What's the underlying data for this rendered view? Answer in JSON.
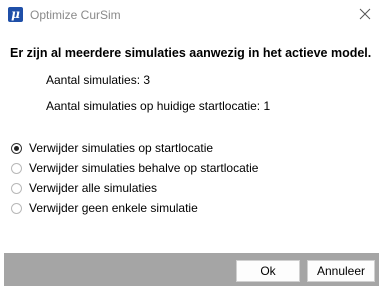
{
  "window": {
    "title": "Optimize CurSim",
    "icon": "mu-app-icon",
    "icon_glyph": "μ"
  },
  "message": {
    "heading": "Er zijn al meerdere simulaties aanwezig in het actieve model.",
    "count_line": "Aantal simulaties: 3",
    "start_line": "Aantal simulaties op huidige startlocatie: 1"
  },
  "options": [
    {
      "label": "Verwijder simulaties op startlocatie",
      "selected": true
    },
    {
      "label": "Verwijder simulaties behalve op startlocatie",
      "selected": false
    },
    {
      "label": "Verwijder alle simulaties",
      "selected": false
    },
    {
      "label": "Verwijder geen enkele simulatie",
      "selected": false
    }
  ],
  "buttons": {
    "ok_label": "Ok",
    "cancel_label": "Annuleer"
  },
  "colors": {
    "footer": "#a5a5a5",
    "title_text": "#8a8a8a",
    "app_icon": "#1f4fa8"
  }
}
